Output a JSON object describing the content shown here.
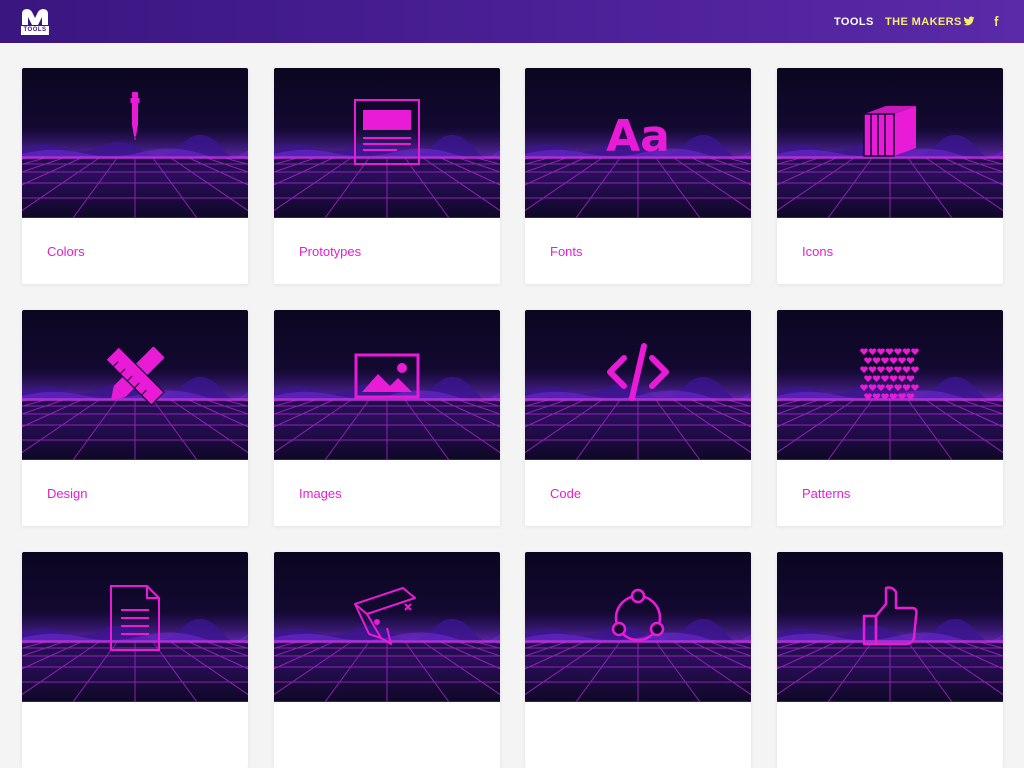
{
  "header": {
    "logo_tag": "TOOLS",
    "nav": {
      "tools": "TOOLS",
      "makers": "THE MAKERS"
    },
    "social_icons": [
      "twitter-icon",
      "facebook-icon"
    ]
  },
  "colors": {
    "header_start": "#3a1680",
    "header_end": "#5a2aa8",
    "accent": "#ea1bd6",
    "makers_link": "#f5ee6a",
    "card_bg": "#ffffff",
    "page_bg": "#f4f4f5"
  },
  "cards": [
    {
      "label": "Colors",
      "icon": "eyedropper-icon"
    },
    {
      "label": "Prototypes",
      "icon": "wireframe-icon"
    },
    {
      "label": "Fonts",
      "icon": "font-icon"
    },
    {
      "label": "Icons",
      "icon": "box-icon"
    },
    {
      "label": "Design",
      "icon": "pencil-ruler-icon"
    },
    {
      "label": "Images",
      "icon": "image-icon"
    },
    {
      "label": "Code",
      "icon": "code-icon"
    },
    {
      "label": "Patterns",
      "icon": "hearts-pattern-icon"
    },
    {
      "label": "",
      "icon": "document-icon"
    },
    {
      "label": "",
      "icon": "swiss-knife-icon"
    },
    {
      "label": "",
      "icon": "share-circle-icon"
    },
    {
      "label": "",
      "icon": "thumbs-up-icon"
    }
  ]
}
